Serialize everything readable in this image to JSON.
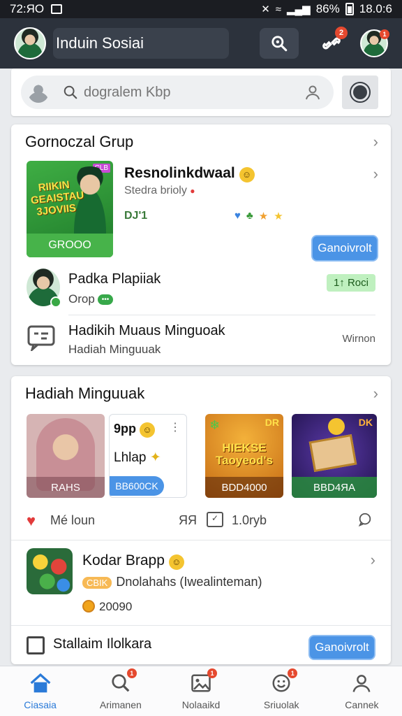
{
  "status_bar": {
    "time": "72:ЯО",
    "battery": "86%",
    "clock_right": "18.0:6"
  },
  "app_bar": {
    "title": "Induin Sosiai"
  },
  "search": {
    "placeholder": "dogralem Kbp"
  },
  "group_section": {
    "title": "Gornoczal Grup",
    "featured": {
      "image_text": "RIIKIN GEAISTAU 3JOVIIS",
      "image_tag": "CLB",
      "image_bar": "GROOO",
      "title": "Resnolinkdwaal",
      "subtitle": "Stedra brioly",
      "meta": "DJ'1",
      "button": "Ganoivrolt"
    },
    "person": {
      "name": "Padka Plapiiak",
      "sub": "Orop",
      "sub_chip": "•••",
      "tag": "1↑ Roci"
    },
    "message": {
      "title": "Hadikih Muaus Minguoak",
      "sub": "Hadiah Minguuak",
      "right": "Wirnon"
    }
  },
  "weekly_section": {
    "title": "Hadiah Minguuak",
    "tiles": [
      {
        "bar": "RAHS"
      },
      {
        "line1": "9pp",
        "line2": "Lhlap",
        "pill": "BB600CK"
      },
      {
        "title": "HIEKSE Taoyeod's",
        "tag": "DR",
        "bar": "BDD4000"
      },
      {
        "tag": "DK",
        "bar": "BBD4ЯA"
      }
    ],
    "actions": {
      "like_label": "Mé loun",
      "gift_label": "ЯЯ",
      "vote_icon": "✓",
      "count": "1.0ryb"
    },
    "app": {
      "title": "Kodar Brapp",
      "chip": "CBIK",
      "subtitle": "Dnolahahs (Iwealinteman)",
      "points": "20090"
    },
    "stall": {
      "title": "Stallaim Ilolkara",
      "button": "Ganoivrolt"
    }
  },
  "bottom_nav": [
    {
      "label": "Ciasaia",
      "icon": "home-icon",
      "active": true
    },
    {
      "label": "Arimanen",
      "icon": "search-icon",
      "badge": "1"
    },
    {
      "label": "Nolaaikd",
      "icon": "image-icon",
      "badge": "1"
    },
    {
      "label": "Sriuolak",
      "icon": "smiley-icon",
      "badge": "1"
    },
    {
      "label": "Cannek",
      "icon": "person-icon"
    }
  ],
  "colors": {
    "accent": "#4b94e6",
    "appbar": "#2c323c",
    "badge": "#e5492f",
    "active_nav": "#2a7ad8"
  }
}
